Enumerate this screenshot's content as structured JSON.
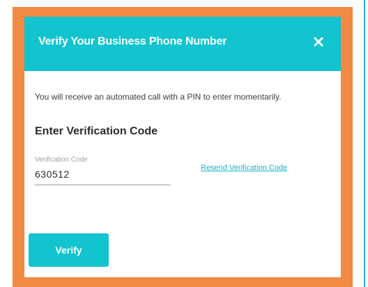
{
  "modal": {
    "title": "Verify Your Business Phone Number",
    "close_icon": "close-icon",
    "message": "You will receive an automated call with a PIN to enter momentarily.",
    "section_title": "Enter Verification Code",
    "field": {
      "label": "Verification Code",
      "value": "630512",
      "placeholder": ""
    },
    "resend_link": "Resend Verification Code",
    "verify_button": "Verify"
  },
  "colors": {
    "frame": "#f28a43",
    "header": "#11c4cf",
    "link": "#15b5c8",
    "button": "#11c4cf"
  }
}
